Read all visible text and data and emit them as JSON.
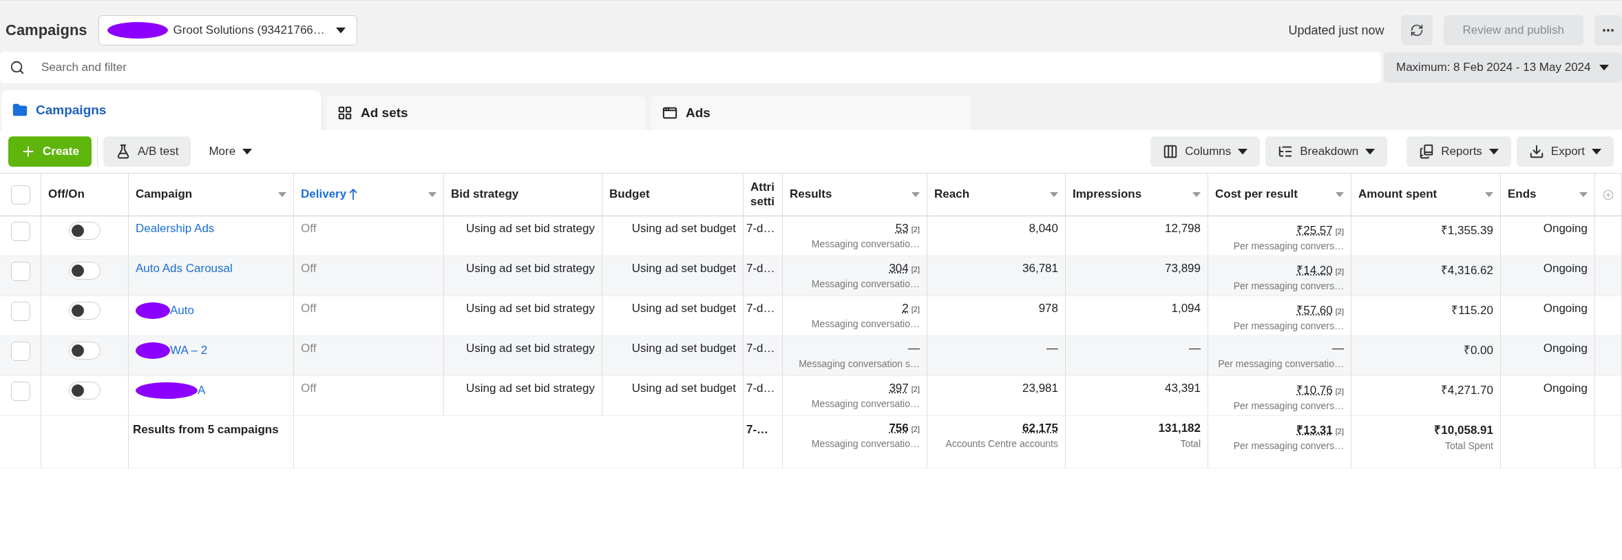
{
  "header": {
    "title": "Campaigns",
    "account": {
      "name": "Groot Solutions (93421766…",
      "redacted": true
    },
    "status": "Updated just now",
    "publish_button": {
      "label": "Review and publish",
      "disabled": true
    }
  },
  "search": {
    "placeholder": "Search and filter"
  },
  "date_range": "Maximum: 8 Feb 2024 - 13 May 2024",
  "tabs": [
    {
      "label": "Campaigns",
      "selected": true
    },
    {
      "label": "Ad sets",
      "selected": false
    },
    {
      "label": "Ads",
      "selected": false
    }
  ],
  "toolbar": {
    "left": [
      {
        "label": "Create",
        "kind": "primary"
      },
      {
        "label": "A/B test",
        "kind": "secondary"
      },
      {
        "label": "More",
        "kind": "menu"
      }
    ],
    "right": [
      {
        "label": "Columns"
      },
      {
        "label": "Breakdown"
      },
      {
        "label": "Reports"
      },
      {
        "label": "Export"
      }
    ]
  },
  "table": {
    "select_all_checked": false,
    "columns": [
      {
        "label": "Off/On",
        "sortable": false,
        "sorted": false
      },
      {
        "label": "Campaign",
        "sortable": true,
        "sorted": false
      },
      {
        "label": "Delivery",
        "sortable": true,
        "sorted": true
      },
      {
        "label": "Bid strategy",
        "sortable": false,
        "sorted": false
      },
      {
        "label": "Budget",
        "sortable": false,
        "sorted": false
      },
      {
        "label": "Attri setti",
        "sortable": false,
        "sorted": false
      },
      {
        "label": "Results",
        "sortable": true,
        "sorted": false
      },
      {
        "label": "Reach",
        "sortable": true,
        "sorted": false
      },
      {
        "label": "Impressions",
        "sortable": true,
        "sorted": false
      },
      {
        "label": "Cost per result",
        "sortable": true,
        "sorted": false
      },
      {
        "label": "Amount spent",
        "sortable": true,
        "sorted": false
      },
      {
        "label": "Ends",
        "sortable": true,
        "sorted": false
      }
    ],
    "rows": [
      {
        "checked": false,
        "on": false,
        "name": "Dealership Ads",
        "redacted": false,
        "delivery": "Off",
        "bid": "Using ad set bid strategy",
        "budget": "Using ad set budget",
        "attribution": "7-d…",
        "results": {
          "value": "53",
          "note": "[2]",
          "sub": "Messaging conversatio…"
        },
        "reach": "8,040",
        "impressions": "12,798",
        "cost": {
          "value": "₹25.57",
          "note": "[2]",
          "sub": "Per messaging convers…"
        },
        "spent": "₹1,355.39",
        "ends": "Ongoing"
      },
      {
        "checked": false,
        "on": false,
        "name": "Auto Ads Carousal",
        "redacted": false,
        "delivery": "Off",
        "bid": "Using ad set bid strategy",
        "budget": "Using ad set budget",
        "attribution": "7-d…",
        "results": {
          "value": "304",
          "note": "[2]",
          "sub": "Messaging conversatio…"
        },
        "reach": "36,781",
        "impressions": "73,899",
        "cost": {
          "value": "₹14.20",
          "note": "[2]",
          "sub": "Per messaging convers…"
        },
        "spent": "₹4,316.62",
        "ends": "Ongoing"
      },
      {
        "checked": false,
        "on": false,
        "name": "Auto",
        "redacted": true,
        "delivery": "Off",
        "bid": "Using ad set bid strategy",
        "budget": "Using ad set budget",
        "attribution": "7-d…",
        "results": {
          "value": "2",
          "note": "[2]",
          "sub": "Messaging conversatio…"
        },
        "reach": "978",
        "impressions": "1,094",
        "cost": {
          "value": "₹57.60",
          "note": "[2]",
          "sub": "Per messaging convers…"
        },
        "spent": "₹115.20",
        "ends": "Ongoing"
      },
      {
        "checked": false,
        "on": false,
        "name": "WA – 2",
        "redacted": true,
        "delivery": "Off",
        "bid": "Using ad set bid strategy",
        "budget": "Using ad set budget",
        "attribution": "7-d…",
        "results": {
          "value": "—",
          "sub": "Messaging conversation s…"
        },
        "reach": "—",
        "impressions": "—",
        "cost": {
          "value": "—",
          "sub": "Per messaging conversatio…"
        },
        "spent": "₹0.00",
        "ends": "Ongoing"
      },
      {
        "checked": false,
        "on": false,
        "name": "A",
        "redacted": true,
        "delivery": "Off",
        "bid": "Using ad set bid strategy",
        "budget": "Using ad set budget",
        "attribution": "7-d…",
        "results": {
          "value": "397",
          "note": "[2]",
          "sub": "Messaging conversatio…"
        },
        "reach": "23,981",
        "impressions": "43,391",
        "cost": {
          "value": "₹10.76",
          "note": "[2]",
          "sub": "Per messaging convers…"
        },
        "spent": "₹4,271.70",
        "ends": "Ongoing"
      }
    ],
    "totals": {
      "label": "Results from 5 campaigns",
      "attribution": "7-…",
      "results": {
        "value": "756",
        "note": "[2]",
        "sub": "Messaging conversatio…"
      },
      "reach": {
        "value": "62,175",
        "sub": "Accounts Centre accounts"
      },
      "impressions": {
        "value": "131,182",
        "sub": "Total"
      },
      "cost": {
        "value": "₹13.31",
        "note": "[2]",
        "sub": "Per messaging convers…"
      },
      "spent": {
        "value": "₹10,058.91",
        "sub": "Total Spent"
      }
    }
  }
}
